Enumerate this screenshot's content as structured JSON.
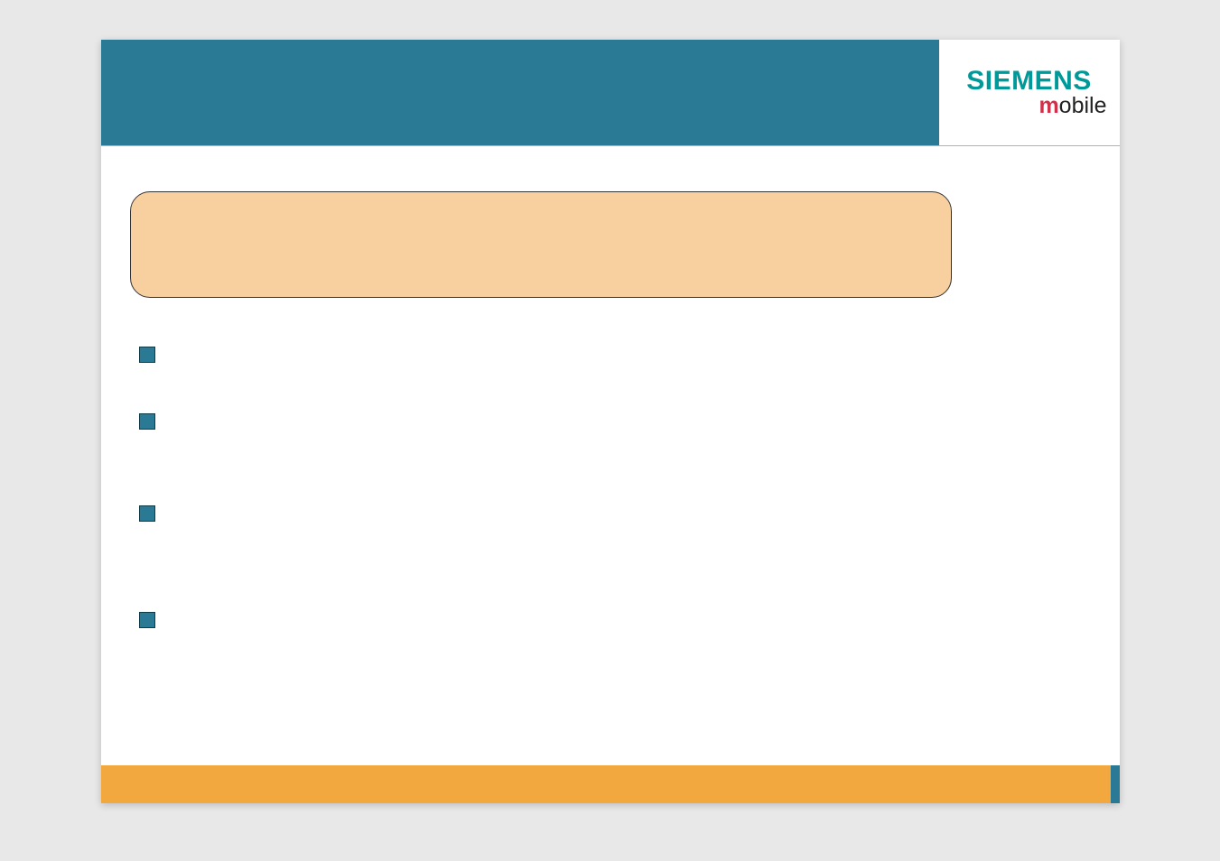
{
  "logo": {
    "siemens": "SIEMENS",
    "mobile_m": "m",
    "mobile_rest": "obile"
  },
  "callout": {
    "text": ""
  },
  "bullets": [
    {
      "text": ""
    },
    {
      "text": ""
    },
    {
      "text": ""
    },
    {
      "text": ""
    }
  ]
}
